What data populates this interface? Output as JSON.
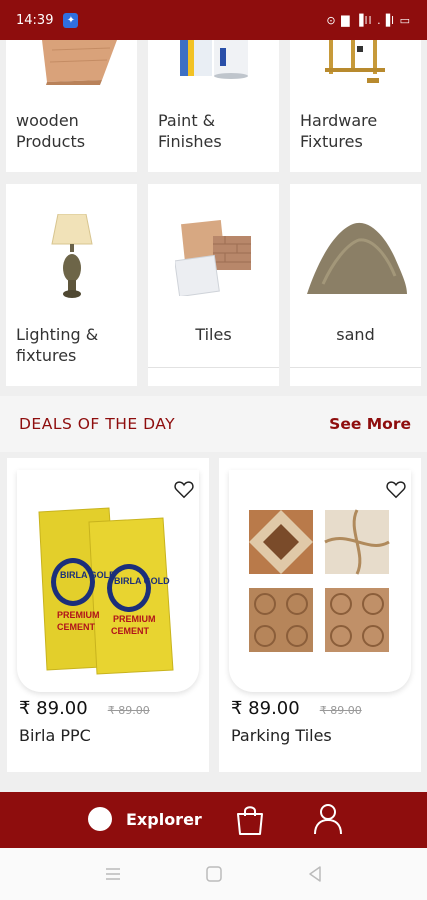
{
  "status_bar": {
    "time": "14:39",
    "right_text": "⊙ ▇ ▐ll .▐l ▭"
  },
  "categories": [
    {
      "label": "wooden Products",
      "icon": "plywood-image"
    },
    {
      "label": "Paint & Finishes",
      "icon": "paint-bucket-image"
    },
    {
      "label": "Hardware Fixtures",
      "icon": "hardware-fixture-image"
    },
    {
      "label": "Lighting & fixtures",
      "icon": "table-lamp-image"
    },
    {
      "label": "Tiles",
      "icon": "tiles-image"
    },
    {
      "label": "sand",
      "icon": "sand-pile-image"
    }
  ],
  "deals": {
    "title": "DEALS OF THE DAY",
    "see_more": "See More"
  },
  "products": [
    {
      "name": "Birla PPC",
      "price": "₹ 89.00",
      "mrp": "₹ 89.00",
      "icon": "cement-bag-image",
      "brand_text": "BIRLA GOLD",
      "tag_line1": "PREMIUM",
      "tag_line2": "CEMENT"
    },
    {
      "name": "Parking Tiles",
      "price": "₹ 89.00",
      "mrp": "₹ 89.00",
      "icon": "parking-tiles-image"
    }
  ],
  "bottom_nav": {
    "explorer_label": "Explorer"
  },
  "colors": {
    "brand": "#8e0d0d",
    "background": "#efefef",
    "card": "#ffffff"
  }
}
